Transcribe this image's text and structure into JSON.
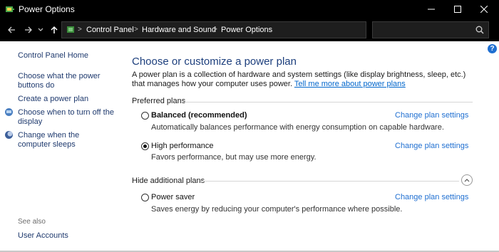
{
  "window": {
    "title": "Power Options",
    "minimize_glyph": "—",
    "maximize_glyph": "□",
    "close_glyph": "✕"
  },
  "address": {
    "crumbs": [
      "Control Panel",
      "Hardware and Sound",
      "Power Options"
    ],
    "separator": ">",
    "search_placeholder": ""
  },
  "help_glyph": "?",
  "sidebar": {
    "home": "Control Panel Home",
    "links": [
      {
        "label": "Choose what the power buttons do",
        "icon": null
      },
      {
        "label": "Create a power plan",
        "icon": null
      },
      {
        "label": "Choose when to turn off the display",
        "icon": "display-icon"
      },
      {
        "label": "Change when the computer sleeps",
        "icon": "moon-icon"
      }
    ],
    "see_also_heading": "See also",
    "see_also": [
      "User Accounts"
    ]
  },
  "main": {
    "heading": "Choose or customize a power plan",
    "description": "A power plan is a collection of hardware and system settings (like display brightness, sleep, etc.) that manages how your computer uses power.",
    "description_link": "Tell me more about power plans",
    "preferred_label": "Preferred plans",
    "hidden_label": "Hide additional plans",
    "plans": [
      {
        "name": "Balanced (recommended)",
        "bold": true,
        "selected": false,
        "desc": "Automatically balances performance with energy consumption on capable hardware.",
        "link": "Change plan settings"
      },
      {
        "name": "High performance",
        "bold": false,
        "selected": true,
        "desc": "Favors performance, but may use more energy.",
        "link": "Change plan settings"
      },
      {
        "name": "Power saver",
        "bold": false,
        "selected": false,
        "desc": "Saves energy by reducing your computer's performance where possible.",
        "link": "Change plan settings"
      }
    ]
  },
  "colors": {
    "titlebar": "#000000",
    "heading": "#1d3f7d",
    "link": "#1f6fd1",
    "sidebar_link": "#1f3a6e"
  }
}
